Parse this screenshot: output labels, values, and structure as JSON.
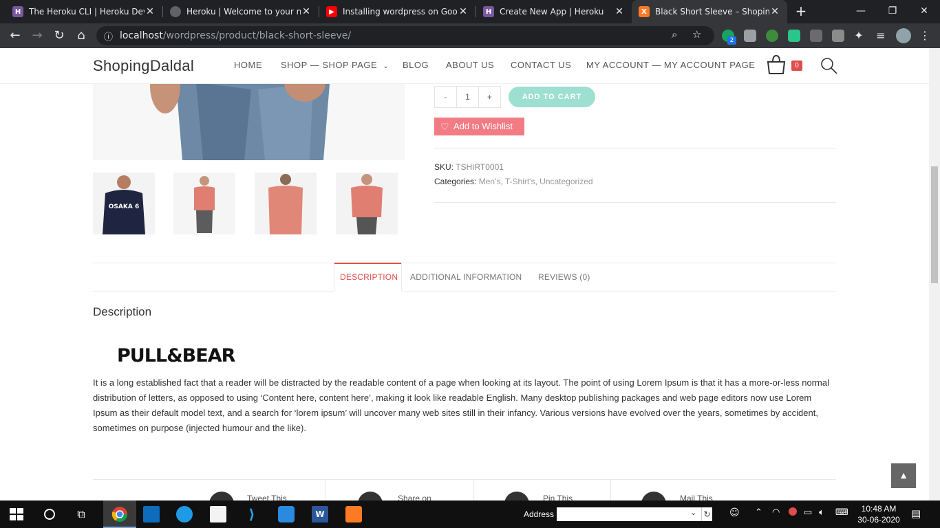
{
  "browser": {
    "tabs": [
      {
        "title": "The Heroku CLI | Heroku Dev C",
        "favicon": "heroku-icon"
      },
      {
        "title": "Heroku | Welcome to your new",
        "favicon": "globe-icon"
      },
      {
        "title": "Installing wordpress on Google",
        "favicon": "youtube-icon"
      },
      {
        "title": "Create New App | Heroku",
        "favicon": "heroku-icon"
      },
      {
        "title": "Black Short Sleeve – ShopingD",
        "favicon": "xampp-icon"
      }
    ],
    "url_host": "localhost",
    "url_path": "/wordpress/product/black-short-sleeve/",
    "extension_badge": "2"
  },
  "site": {
    "logo": "ShopingDaldal",
    "nav": [
      "HOME",
      "SHOP — SHOP PAGE",
      "BLOG",
      "ABOUT US",
      "CONTACT US",
      "MY ACCOUNT — MY ACCOUNT PAGE"
    ],
    "cart_count": "0"
  },
  "product": {
    "qty_minus": "-",
    "qty_value": "1",
    "qty_plus": "+",
    "add_to_cart": "ADD TO CART",
    "wishlist": "Add to Wishlist",
    "sku_label": "SKU:",
    "sku_value": "TSHIRT0001",
    "categories_label": "Categories:",
    "categories": [
      "Men's",
      "T-Shirt's",
      "Uncategorized"
    ],
    "thumbnail_print": "OSAKA 6",
    "tabs": [
      "DESCRIPTION",
      "ADDITIONAL INFORMATION",
      "REVIEWS (0)"
    ],
    "description_heading": "Description",
    "brand": "PULL&BEAR",
    "description": "It is a long established fact that a reader will be distracted by the readable content of a page when looking at its layout. The point of using Lorem Ipsum is that it has a more-or-less normal distribution of letters, as opposed to using ‘Content here, content here’, making it look like readable English. Many desktop publishing packages and web page editors now use Lorem Ipsum as their default model text, and a search for ‘lorem ipsum’ will uncover many web sites still in their infancy. Various versions have evolved over the years, sometimes by accident, sometimes on purpose (injected humour and the like).",
    "share": [
      "Tweet This",
      "Share on",
      "Pin This",
      "Mail This"
    ]
  },
  "taskbar": {
    "address_label": "Address",
    "time": "10:48 AM",
    "date": "30-06-2020"
  },
  "colors": {
    "accent": "#e14c4c",
    "wishlist": "#f27b84",
    "add_to_cart": "#9ddfd1"
  }
}
